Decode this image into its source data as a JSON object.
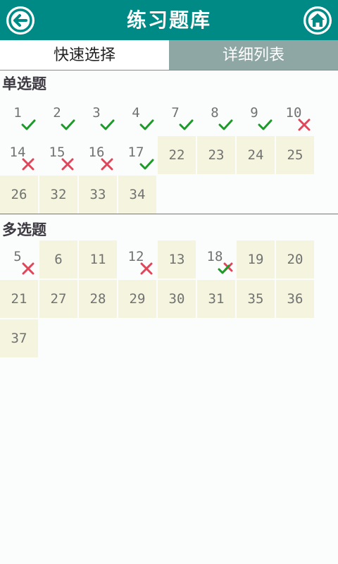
{
  "header": {
    "title": "练习题库",
    "back_icon": "arrow-left-circle-icon",
    "home_icon": "home-icon",
    "color": "#008a85"
  },
  "tabs": [
    {
      "label": "快速选择",
      "active": true
    },
    {
      "label": "详细列表",
      "active": false
    }
  ],
  "sections": [
    {
      "title": "单选题",
      "questions": [
        {
          "number": "1",
          "status": "correct"
        },
        {
          "number": "2",
          "status": "correct"
        },
        {
          "number": "3",
          "status": "correct"
        },
        {
          "number": "4",
          "status": "correct"
        },
        {
          "number": "7",
          "status": "correct"
        },
        {
          "number": "8",
          "status": "correct"
        },
        {
          "number": "9",
          "status": "correct"
        },
        {
          "number": "10",
          "status": "wrong"
        },
        {
          "number": "14",
          "status": "wrong"
        },
        {
          "number": "15",
          "status": "wrong"
        },
        {
          "number": "16",
          "status": "wrong"
        },
        {
          "number": "17",
          "status": "correct"
        },
        {
          "number": "22",
          "status": "unanswered"
        },
        {
          "number": "23",
          "status": "unanswered"
        },
        {
          "number": "24",
          "status": "unanswered"
        },
        {
          "number": "25",
          "status": "unanswered"
        },
        {
          "number": "26",
          "status": "unanswered"
        },
        {
          "number": "32",
          "status": "unanswered"
        },
        {
          "number": "33",
          "status": "unanswered"
        },
        {
          "number": "34",
          "status": "unanswered"
        }
      ]
    },
    {
      "title": "多选题",
      "questions": [
        {
          "number": "5",
          "status": "wrong"
        },
        {
          "number": "6",
          "status": "unanswered"
        },
        {
          "number": "11",
          "status": "unanswered"
        },
        {
          "number": "12",
          "status": "wrong"
        },
        {
          "number": "13",
          "status": "unanswered"
        },
        {
          "number": "18",
          "status": "partial"
        },
        {
          "number": "19",
          "status": "unanswered"
        },
        {
          "number": "20",
          "status": "unanswered"
        },
        {
          "number": "21",
          "status": "unanswered"
        },
        {
          "number": "27",
          "status": "unanswered"
        },
        {
          "number": "28",
          "status": "unanswered"
        },
        {
          "number": "29",
          "status": "unanswered"
        },
        {
          "number": "30",
          "status": "unanswered"
        },
        {
          "number": "31",
          "status": "unanswered"
        },
        {
          "number": "35",
          "status": "unanswered"
        },
        {
          "number": "36",
          "status": "unanswered"
        },
        {
          "number": "37",
          "status": "unanswered"
        }
      ]
    }
  ],
  "status_colors": {
    "correct": "#1e9a2a",
    "wrong": "#e0465a",
    "unanswered_bg": "#f4f4df"
  }
}
